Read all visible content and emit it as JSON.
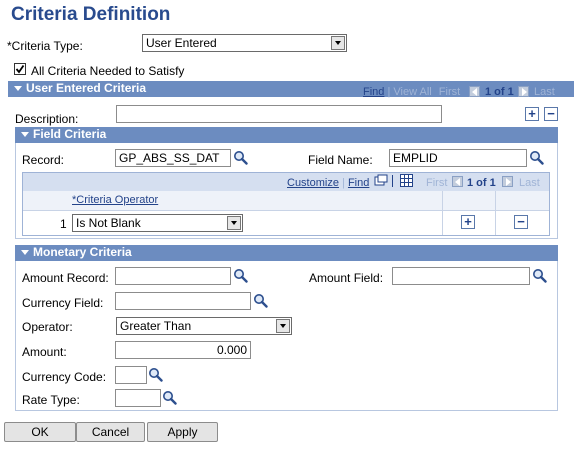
{
  "page_title": "Criteria Definition",
  "criteria_type": {
    "label": "*Criteria Type:",
    "value": "User Entered"
  },
  "all_criteria": {
    "label": "All Criteria Needed to Satisfy",
    "checked": true
  },
  "user_entered": {
    "header": "User Entered Criteria",
    "nav": {
      "find": "Find",
      "sep": "|",
      "view_all": "View All",
      "first": "First",
      "count": "1 of 1",
      "last": "Last"
    },
    "description": {
      "label": "Description:",
      "value": ""
    },
    "add_symbol": "+",
    "remove_symbol": "−"
  },
  "field_criteria": {
    "header": "Field Criteria",
    "record": {
      "label": "Record:",
      "value": "GP_ABS_SS_DAT"
    },
    "field_name": {
      "label": "Field Name:",
      "value": "EMPLID"
    },
    "grid_nav": {
      "customize": "Customize",
      "sep": "|",
      "find": "Find",
      "first": "First",
      "count": "1 of 1",
      "last": "Last"
    },
    "column_header": "*Criteria Operator",
    "rows": [
      {
        "num": "1",
        "operator": "Is Not Blank"
      }
    ],
    "add_symbol": "+",
    "remove_symbol": "−"
  },
  "monetary": {
    "header": "Monetary Criteria",
    "amount_record": {
      "label": "Amount Record:",
      "value": ""
    },
    "amount_field": {
      "label": "Amount Field:",
      "value": ""
    },
    "currency_field": {
      "label": "Currency Field:",
      "value": ""
    },
    "operator": {
      "label": "Operator:",
      "value": "Greater Than"
    },
    "amount": {
      "label": "Amount:",
      "value": "0.000"
    },
    "currency_code": {
      "label": "Currency Code:",
      "value": ""
    },
    "rate_type": {
      "label": "Rate Type:",
      "value": ""
    }
  },
  "buttons": {
    "ok": "OK",
    "cancel": "Cancel",
    "apply": "Apply"
  },
  "colors": {
    "title": "#294b8e",
    "header_bg": "#6c8cc0",
    "link": "#23438a"
  }
}
